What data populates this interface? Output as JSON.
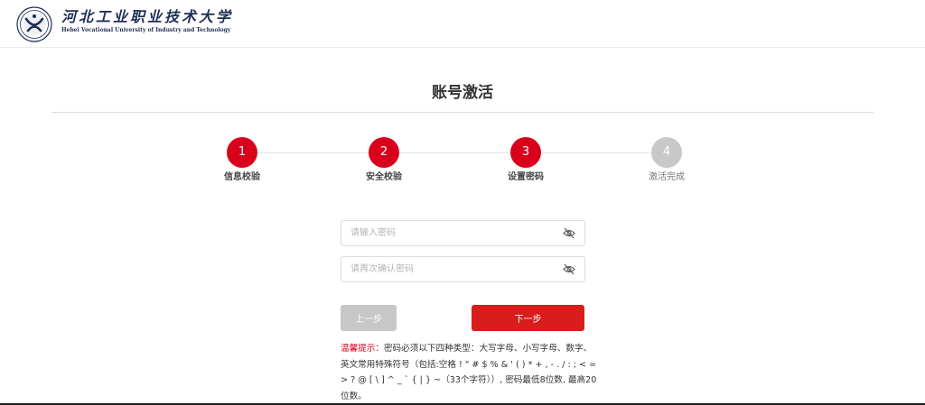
{
  "header": {
    "logo_cn": "河北工业职业技术大学",
    "logo_en": "Hebei Vocational University of Industry and Technology"
  },
  "page": {
    "title": "账号激活"
  },
  "steps": [
    {
      "number": "1",
      "label": "信息校验",
      "status": "done"
    },
    {
      "number": "2",
      "label": "安全校验",
      "status": "done"
    },
    {
      "number": "3",
      "label": "设置密码",
      "status": "current"
    },
    {
      "number": "4",
      "label": "激活完成",
      "status": "pending"
    }
  ],
  "form": {
    "password_placeholder": "请输入密码",
    "password_value": "",
    "confirm_placeholder": "请再次确认密码",
    "confirm_value": ""
  },
  "buttons": {
    "prev": "上一步",
    "next": "下一步"
  },
  "tip": {
    "label": "温馨提示：",
    "text": "密码必须以下四种类型：大写字母、小写字母、数字、英文常用特殊符号（包括:空格 ! \" # $ % & ' ( ) * + , - . / : ; < = > ? @ [ \\ ] ^ _ ` { | } ~（33个字符））, 密码最低8位数, 最高20位数。"
  },
  "colors": {
    "accent": "#d9001b",
    "button_next": "#d91c1c",
    "button_prev": "#c7c7c7",
    "step_inactive": "#c8c8c8"
  },
  "icons": {
    "logo": "university-seal-icon",
    "password_toggle": "eye-off-icon",
    "confirm_toggle": "eye-off-icon"
  }
}
